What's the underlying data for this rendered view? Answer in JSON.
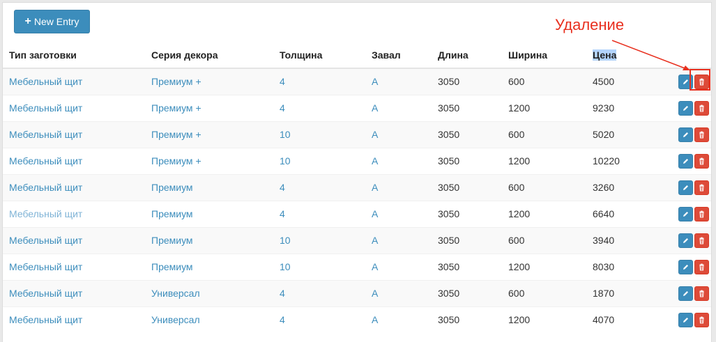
{
  "toolbar": {
    "new_entry_label": "New Entry",
    "plus_icon": "plus-icon"
  },
  "annotation": {
    "label": "Удаление",
    "color": "#e8301f"
  },
  "colors": {
    "accent": "#3c8dbc",
    "danger": "#dd4b39"
  },
  "table": {
    "columns": [
      "Тип заготовки",
      "Серия декора",
      "Толщина",
      "Завал",
      "Длина",
      "Ширина",
      "Цена"
    ],
    "rows": [
      {
        "type": "Мебельный щит",
        "series": "Премиум +",
        "thickness": "4",
        "zaval": "A",
        "length": "3050",
        "width": "600",
        "price": "4500"
      },
      {
        "type": "Мебельный щит",
        "series": "Премиум +",
        "thickness": "4",
        "zaval": "A",
        "length": "3050",
        "width": "1200",
        "price": "9230"
      },
      {
        "type": "Мебельный щит",
        "series": "Премиум +",
        "thickness": "10",
        "zaval": "A",
        "length": "3050",
        "width": "600",
        "price": "5020"
      },
      {
        "type": "Мебельный щит",
        "series": "Премиум +",
        "thickness": "10",
        "zaval": "A",
        "length": "3050",
        "width": "1200",
        "price": "10220"
      },
      {
        "type": "Мебельный щит",
        "series": "Премиум",
        "thickness": "4",
        "zaval": "A",
        "length": "3050",
        "width": "600",
        "price": "3260"
      },
      {
        "type": "Мебельный щит",
        "series": "Премиум",
        "thickness": "4",
        "zaval": "A",
        "length": "3050",
        "width": "1200",
        "price": "6640"
      },
      {
        "type": "Мебельный щит",
        "series": "Премиум",
        "thickness": "10",
        "zaval": "A",
        "length": "3050",
        "width": "600",
        "price": "3940"
      },
      {
        "type": "Мебельный щит",
        "series": "Премиум",
        "thickness": "10",
        "zaval": "A",
        "length": "3050",
        "width": "1200",
        "price": "8030"
      },
      {
        "type": "Мебельный щит",
        "series": "Универсал",
        "thickness": "4",
        "zaval": "A",
        "length": "3050",
        "width": "600",
        "price": "1870"
      },
      {
        "type": "Мебельный щит",
        "series": "Универсал",
        "thickness": "4",
        "zaval": "A",
        "length": "3050",
        "width": "1200",
        "price": "4070"
      }
    ]
  }
}
